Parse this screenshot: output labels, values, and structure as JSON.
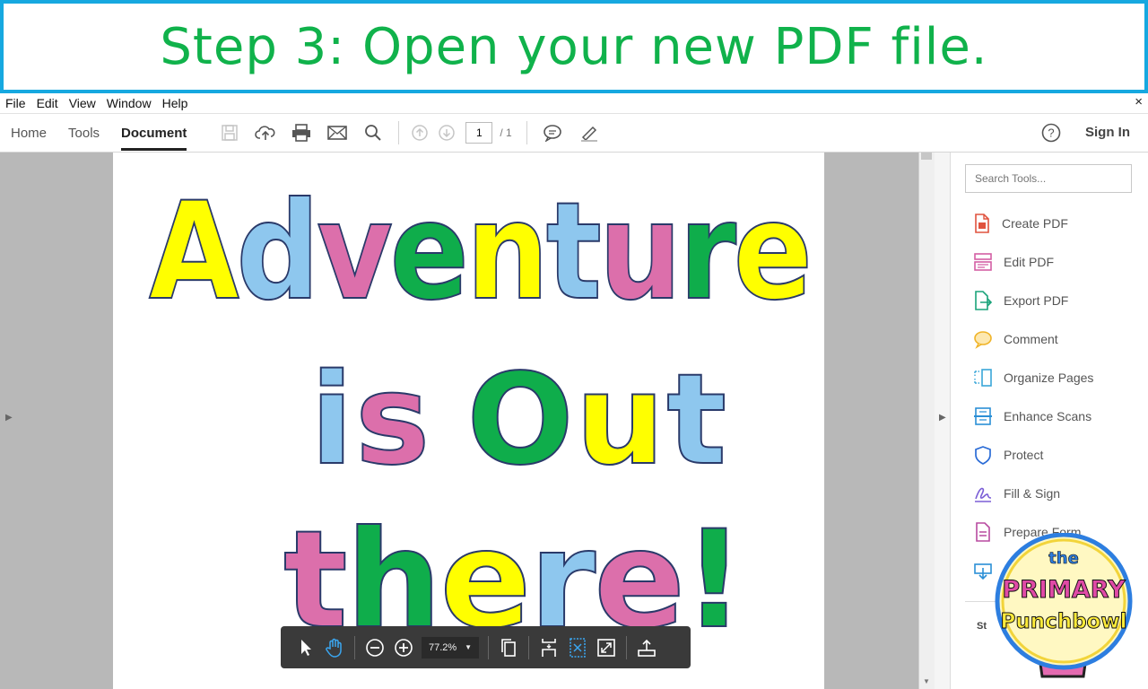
{
  "banner": {
    "title": "Step 3: Open your new PDF file."
  },
  "menu": {
    "items": [
      "File",
      "Edit",
      "View",
      "Window",
      "Help"
    ],
    "close": "×"
  },
  "toolbar": {
    "tabs": [
      "Home",
      "Tools",
      "Document"
    ],
    "active_tab": "Document",
    "page_current": "1",
    "page_total": "/ 1",
    "signin": "Sign In"
  },
  "document": {
    "lines": [
      {
        "text": "Adventure",
        "letter_colors": [
          "#ffff00",
          "#8ec7ee",
          "#dc6fab",
          "#0fad4b",
          "#ffff00",
          "#8ec7ee",
          "#dc6fab",
          "#0fad4b",
          "#ffff00"
        ]
      },
      {
        "text": "is Out",
        "letter_colors": [
          "#8ec7ee",
          "#dc6fab",
          "#0fad4b",
          "#ffff00",
          "#8ec7ee"
        ]
      },
      {
        "text": "there!",
        "letter_colors": [
          "#dc6fab",
          "#0fad4b",
          "#ffff00",
          "#8ec7ee",
          "#dc6fab",
          "#0fad4b"
        ]
      }
    ]
  },
  "tools_pane": {
    "search_placeholder": "Search Tools...",
    "items": [
      {
        "label": "Create PDF",
        "icon": "create-pdf-icon",
        "color": "#e0533f"
      },
      {
        "label": "Edit PDF",
        "icon": "edit-pdf-icon",
        "color": "#d45fa4"
      },
      {
        "label": "Export PDF",
        "icon": "export-pdf-icon",
        "color": "#1aa37a"
      },
      {
        "label": "Comment",
        "icon": "comment-icon",
        "color": "#f0b429"
      },
      {
        "label": "Organize Pages",
        "icon": "organize-pages-icon",
        "color": "#3aa6d8"
      },
      {
        "label": "Enhance Scans",
        "icon": "enhance-scans-icon",
        "color": "#2b8fd6"
      },
      {
        "label": "Protect",
        "icon": "protect-icon",
        "color": "#2b6cd6"
      },
      {
        "label": "Fill & Sign",
        "icon": "fill-sign-icon",
        "color": "#7b5fd6"
      },
      {
        "label": "Prepare Form",
        "icon": "prepare-form-icon",
        "color": "#b84aa0"
      },
      {
        "label": "",
        "icon": "send-for-signature-icon",
        "color": "#2b8fd6"
      }
    ],
    "more_label": "St"
  },
  "float_toolbar": {
    "zoom": "77.2%"
  },
  "logo": {
    "line1": "the",
    "line2": "PRIMARY",
    "line3": "Punchbowl"
  },
  "colors": {
    "banner_border": "#16a8e0",
    "banner_text": "#10b24b",
    "accent": "#1a9be0"
  }
}
